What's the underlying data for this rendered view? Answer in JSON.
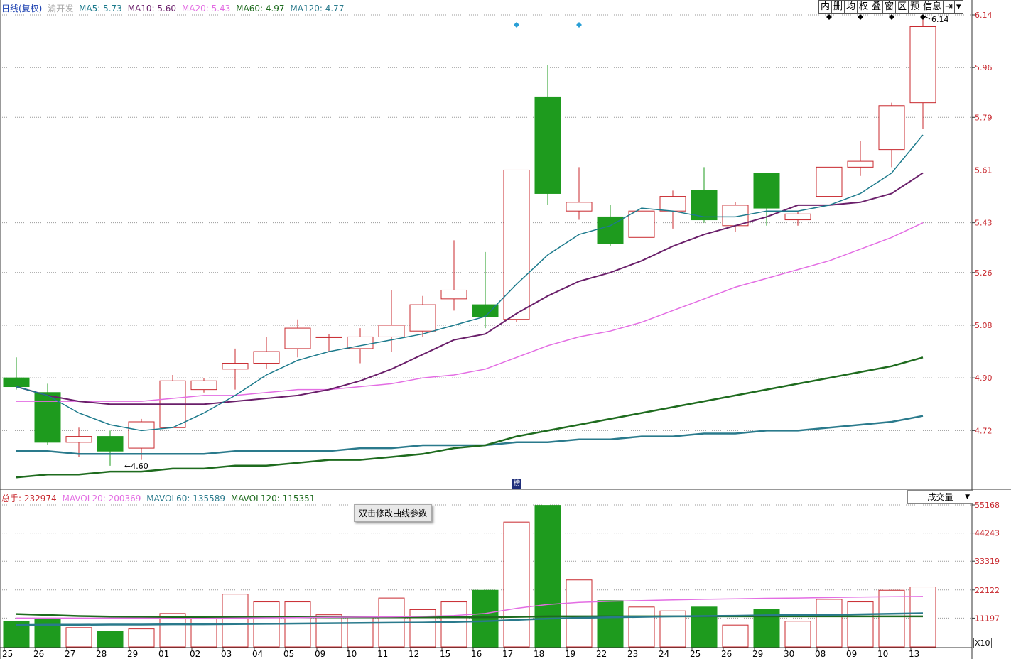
{
  "header": {
    "period": "日线(复权)",
    "stock_name": "渝开发",
    "ma": [
      {
        "label": "MA5: 5.73",
        "color": "#1c7a8c"
      },
      {
        "label": "MA10: 5.60",
        "color": "#6a1f6a"
      },
      {
        "label": "MA20: 5.43",
        "color": "#e36de3"
      },
      {
        "label": "MA60: 4.97",
        "color": "#1e6b1e"
      },
      {
        "label": "MA120: 4.77",
        "color": "#2a7a8c"
      }
    ]
  },
  "toolbar": {
    "items": [
      "内",
      "删",
      "均",
      "权",
      "叠",
      "窗",
      "区",
      "预",
      "信息",
      "⇥",
      "▾"
    ]
  },
  "volume_header": {
    "total_label": "总手:",
    "total_value": "232974",
    "mavol": [
      {
        "label": "MAVOL20: 200369",
        "color": "#e36de3"
      },
      {
        "label": "MAVOL60: 135589",
        "color": "#2a7a8c"
      },
      {
        "label": "MAVOL120: 115351",
        "color": "#1e6b1e"
      }
    ]
  },
  "volume_dropdown": "成交量",
  "tooltip": "双击修改曲线参数",
  "scale_button": "X10",
  "marker_label": "榜",
  "annotations": {
    "high": "6.14",
    "low": "4.60"
  },
  "colors": {
    "up": "#c8282e",
    "down": "#1e9b1e",
    "grid": "#999999",
    "axis_text": "#c8282e"
  },
  "chart_data": {
    "type": "candlestick",
    "price_axis": {
      "ticks": [
        "6.14",
        "5.96",
        "5.79",
        "5.61",
        "5.43",
        "5.26",
        "5.08",
        "4.90",
        "4.72"
      ]
    },
    "volume_axis": {
      "ticks": [
        "55168",
        "44243",
        "33319",
        "22122",
        "11197"
      ]
    },
    "dates": [
      "25",
      "26",
      "27",
      "28",
      "29",
      "01",
      "02",
      "03",
      "04",
      "05",
      "09",
      "10",
      "11",
      "12",
      "15",
      "16",
      "17",
      "18",
      "19",
      "22",
      "23",
      "24",
      "25",
      "26",
      "29",
      "30",
      "08",
      "09",
      "10",
      "13"
    ],
    "ohlc": [
      [
        4.9,
        4.97,
        4.86,
        4.87
      ],
      [
        4.85,
        4.88,
        4.67,
        4.68
      ],
      [
        4.68,
        4.73,
        4.63,
        4.7
      ],
      [
        4.7,
        4.72,
        4.6,
        4.65
      ],
      [
        4.66,
        4.76,
        4.62,
        4.75
      ],
      [
        4.73,
        4.91,
        4.73,
        4.89
      ],
      [
        4.86,
        4.9,
        4.85,
        4.89
      ],
      [
        4.93,
        5.0,
        4.86,
        4.95
      ],
      [
        4.95,
        5.04,
        4.93,
        4.99
      ],
      [
        5.0,
        5.1,
        4.97,
        5.07
      ],
      [
        5.04,
        5.05,
        4.99,
        5.04
      ],
      [
        5.0,
        5.07,
        4.95,
        5.04
      ],
      [
        5.04,
        5.2,
        4.99,
        5.08
      ],
      [
        5.06,
        5.18,
        5.04,
        5.15
      ],
      [
        5.17,
        5.37,
        5.13,
        5.2
      ],
      [
        5.15,
        5.33,
        5.07,
        5.11
      ],
      [
        5.1,
        5.61,
        5.09,
        5.61
      ],
      [
        5.86,
        5.97,
        5.49,
        5.53
      ],
      [
        5.47,
        5.62,
        5.44,
        5.5
      ],
      [
        5.45,
        5.49,
        5.35,
        5.36
      ],
      [
        5.38,
        5.47,
        5.38,
        5.47
      ],
      [
        5.47,
        5.54,
        5.41,
        5.52
      ],
      [
        5.54,
        5.62,
        5.43,
        5.44
      ],
      [
        5.42,
        5.5,
        5.4,
        5.49
      ],
      [
        5.6,
        5.6,
        5.42,
        5.48
      ],
      [
        5.44,
        5.47,
        5.42,
        5.46
      ],
      [
        5.52,
        5.62,
        5.52,
        5.62
      ],
      [
        5.62,
        5.71,
        5.59,
        5.64
      ],
      [
        5.68,
        5.84,
        5.62,
        5.83
      ],
      [
        5.84,
        6.14,
        5.75,
        6.1
      ]
    ],
    "ma5": [
      4.87,
      4.84,
      4.78,
      4.74,
      4.72,
      4.73,
      4.78,
      4.84,
      4.91,
      4.96,
      4.99,
      5.01,
      5.03,
      5.05,
      5.08,
      5.11,
      5.22,
      5.32,
      5.39,
      5.42,
      5.48,
      5.47,
      5.45,
      5.45,
      5.47,
      5.47,
      5.49,
      5.53,
      5.6,
      5.73
    ],
    "ma10": [
      4.87,
      4.84,
      4.82,
      4.81,
      4.81,
      4.81,
      4.81,
      4.82,
      4.83,
      4.84,
      4.86,
      4.89,
      4.93,
      4.98,
      5.03,
      5.05,
      5.12,
      5.18,
      5.23,
      5.26,
      5.3,
      5.35,
      5.39,
      5.42,
      5.45,
      5.49,
      5.49,
      5.5,
      5.53,
      5.6
    ],
    "ma20": [
      4.82,
      4.82,
      4.82,
      4.82,
      4.82,
      4.83,
      4.84,
      4.84,
      4.85,
      4.86,
      4.86,
      4.87,
      4.88,
      4.9,
      4.91,
      4.93,
      4.97,
      5.01,
      5.04,
      5.06,
      5.09,
      5.13,
      5.17,
      5.21,
      5.24,
      5.27,
      5.3,
      5.34,
      5.38,
      5.43
    ],
    "ma60": [
      4.56,
      4.57,
      4.57,
      4.58,
      4.58,
      4.59,
      4.59,
      4.6,
      4.6,
      4.61,
      4.62,
      4.62,
      4.63,
      4.64,
      4.66,
      4.67,
      4.7,
      4.72,
      4.74,
      4.76,
      4.78,
      4.8,
      4.82,
      4.84,
      4.86,
      4.88,
      4.9,
      4.92,
      4.94,
      4.97
    ],
    "ma120": [
      4.65,
      4.65,
      4.64,
      4.64,
      4.64,
      4.64,
      4.64,
      4.65,
      4.65,
      4.65,
      4.65,
      4.66,
      4.66,
      4.67,
      4.67,
      4.67,
      4.68,
      4.68,
      4.69,
      4.69,
      4.7,
      4.7,
      4.71,
      4.71,
      4.72,
      4.72,
      4.73,
      4.74,
      4.75,
      4.77
    ],
    "volume": [
      10000,
      11000,
      7500,
      6000,
      7000,
      13000,
      12000,
      20500,
      17500,
      17500,
      12500,
      12000,
      19000,
      14500,
      17500,
      22000,
      48500,
      55000,
      26000,
      18000,
      15500,
      14000,
      15500,
      8500,
      14500,
      10000,
      18500,
      17500,
      22000,
      23300
    ],
    "mavol20": [
      11200,
      11200,
      11200,
      11200,
      11200,
      11100,
      11100,
      11200,
      11300,
      11400,
      11500,
      11600,
      11700,
      11900,
      12200,
      13000,
      15000,
      16500,
      17300,
      17700,
      18000,
      18300,
      18500,
      18700,
      18900,
      19000,
      19200,
      19400,
      19500,
      19600
    ],
    "mavol60": [
      8500,
      8600,
      8600,
      8700,
      8700,
      8800,
      8800,
      8900,
      9000,
      9100,
      9200,
      9300,
      9400,
      9500,
      9700,
      10000,
      10500,
      11000,
      11300,
      11500,
      11700,
      11900,
      12000,
      12100,
      12300,
      12400,
      12500,
      12700,
      12900,
      13100
    ],
    "mavol120": [
      12800,
      12400,
      12000,
      11800,
      11600,
      11500,
      11500,
      11500,
      11500,
      11500,
      11500,
      11500,
      11500,
      11500,
      11500,
      11500,
      11700,
      11900,
      11900,
      11900,
      11900,
      11900,
      11900,
      11900,
      11900,
      11900,
      11900,
      11900,
      11900,
      11900
    ]
  }
}
